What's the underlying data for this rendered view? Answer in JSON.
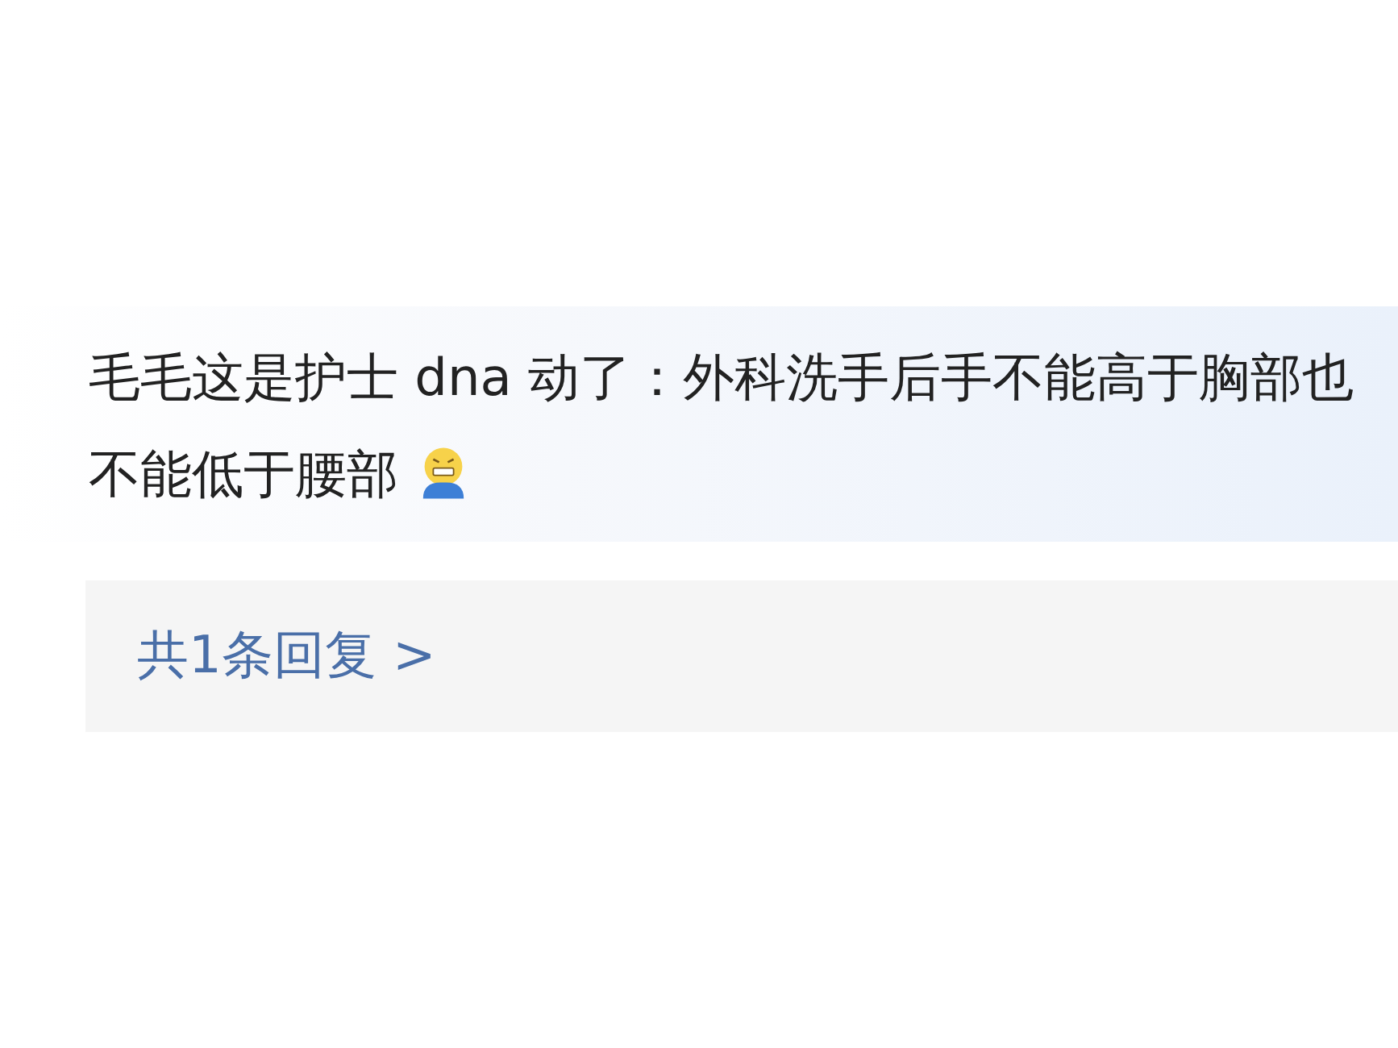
{
  "comment": {
    "text": "毛毛这是护士 dna 动了：外科洗手后手不能高于胸部也不能低于腰部"
  },
  "replies": {
    "label": "共1条回复 >"
  }
}
